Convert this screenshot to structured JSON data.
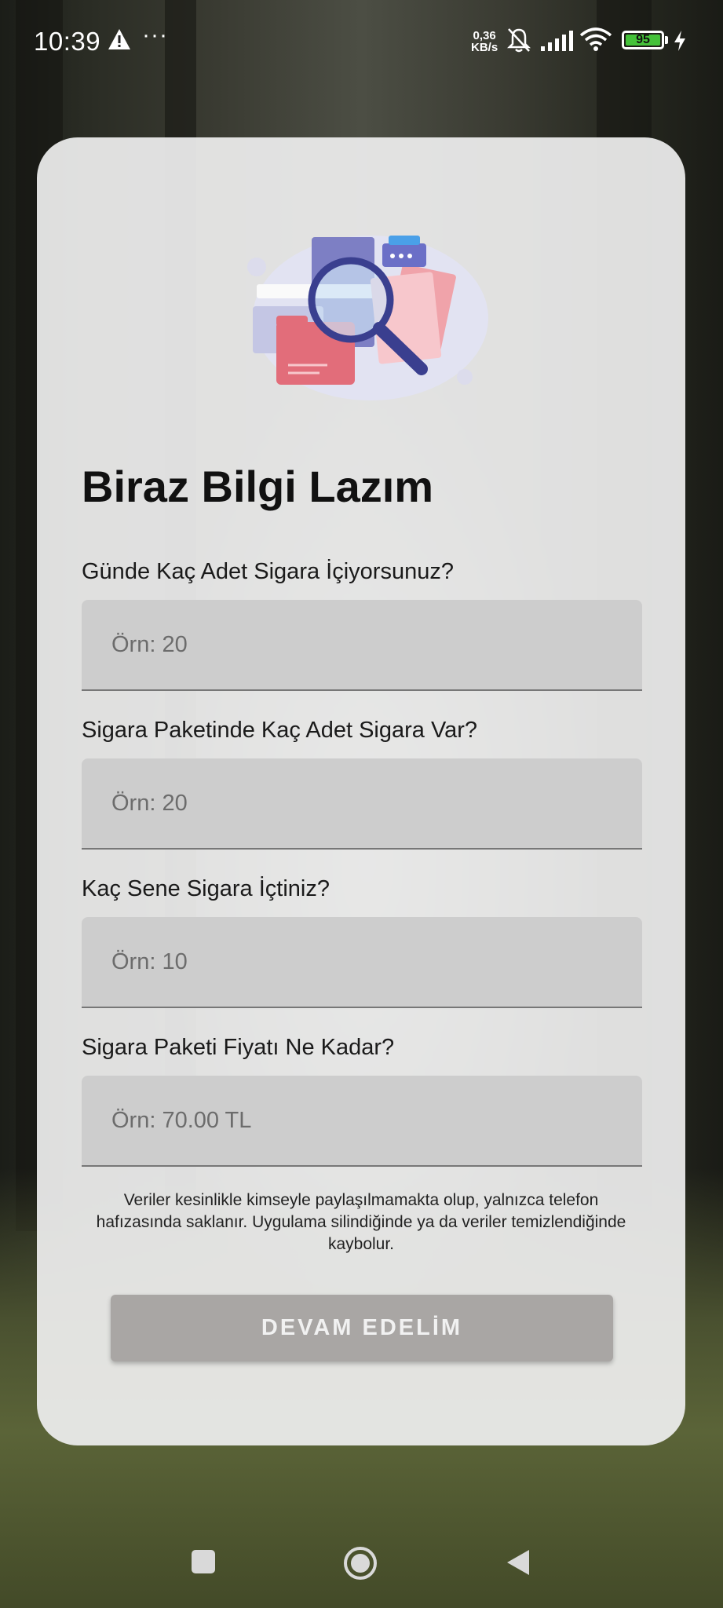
{
  "status_bar": {
    "time": "10:39",
    "overflow": "···",
    "net_speed_value": "0,36",
    "net_speed_unit": "KB/s",
    "battery_level": "95",
    "icons": [
      "warning-icon",
      "mute-bell-icon",
      "signal-icon",
      "wifi-icon",
      "battery-icon",
      "charging-bolt-icon"
    ]
  },
  "form": {
    "title": "Biraz Bilgi Lazım",
    "fields": [
      {
        "label": "Günde Kaç Adet Sigara İçiyorsunuz?",
        "placeholder": "Örn: 20",
        "value": ""
      },
      {
        "label": "Sigara Paketinde Kaç Adet Sigara Var?",
        "placeholder": "Örn: 20",
        "value": ""
      },
      {
        "label": "Kaç Sene Sigara İçtiniz?",
        "placeholder": "Örn: 10",
        "value": ""
      },
      {
        "label": "Sigara Paketi Fiyatı Ne Kadar?",
        "placeholder": "Örn: 70.00 TL",
        "value": ""
      }
    ],
    "disclaimer": "Veriler kesinlikle kimseyle paylaşılmamakta olup, yalnızca telefon hafızasında saklanır. Uygulama silindiğinde ya da veriler temizlendiğinde kaybolur.",
    "continue_label": "DEVAM EDELİM"
  },
  "colors": {
    "card_background": "#eeeeee",
    "field_background": "#cdcdcd",
    "button_background": "#a9a6a4",
    "battery_green": "#45c23a"
  },
  "nav_bar": {
    "icons": [
      "recents-square-icon",
      "home-circle-icon",
      "back-triangle-icon"
    ]
  }
}
